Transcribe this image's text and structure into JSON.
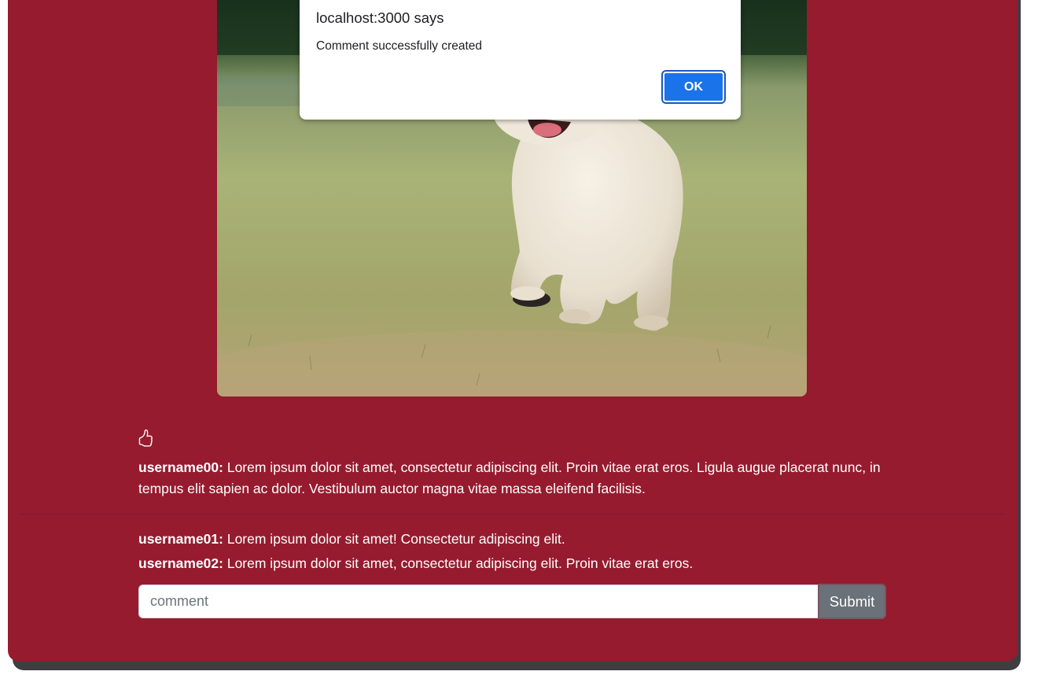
{
  "post": {
    "image_alt": "puppy running on grass",
    "like_icon": "thumbs-up-icon"
  },
  "comments": [
    {
      "user": "username00:",
      "text": " Lorem ipsum dolor sit amet, consectetur adipiscing elit. Proin vitae erat eros. Ligula augue placerat nunc, in tempus elit sapien ac dolor. Vestibulum auctor magna vitae massa eleifend facilisis."
    },
    {
      "user": "username01:",
      "text": " Lorem ipsum dolor sit amet! Consectetur adipiscing elit."
    },
    {
      "user": "username02:",
      "text": " Lorem ipsum dolor sit amet, consectetur adipiscing elit. Proin vitae erat eros."
    }
  ],
  "comment_form": {
    "placeholder": "comment",
    "submit_label": "Submit"
  },
  "dialog": {
    "title": "localhost:3000 says",
    "message": "Comment successfully created",
    "ok_label": "OK"
  },
  "colors": {
    "card_background": "#961b2f",
    "submit_button": "#6b7178",
    "ok_button": "#1a73e8"
  }
}
